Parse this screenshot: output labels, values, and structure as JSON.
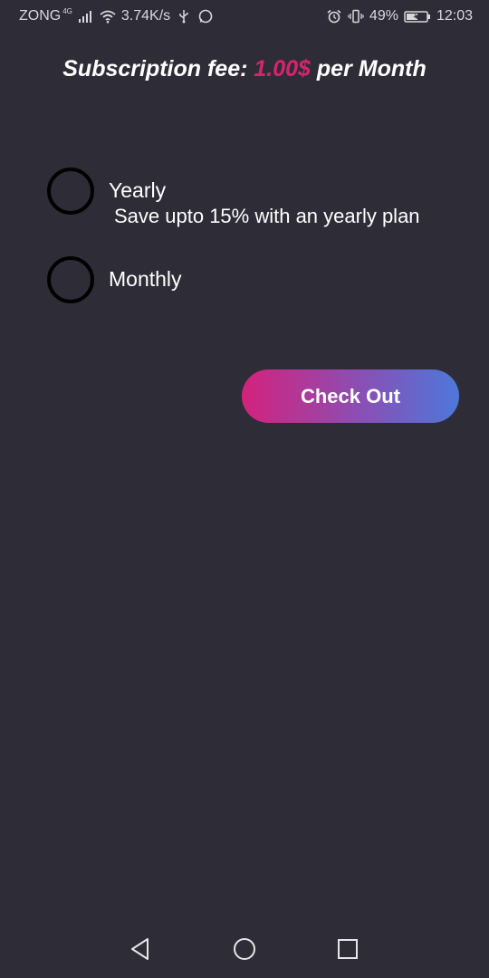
{
  "status_bar": {
    "carrier": "ZONG",
    "network_type": "4G",
    "speed": "3.74K/s",
    "battery": "49%",
    "time": "12:03",
    "icons": [
      "signal-icon",
      "wifi-icon",
      "usb-icon",
      "whatsapp-icon",
      "alarm-icon",
      "vibrate-icon",
      "battery-icon"
    ]
  },
  "header": {
    "prefix": "Subscription fee:",
    "price": "1.00$",
    "suffix": "per Month",
    "price_color": "#d6246e"
  },
  "options": [
    {
      "label": "Yearly",
      "sublabel": "Save upto 15% with an yearly plan",
      "selected": false
    },
    {
      "label": "Monthly",
      "selected": false
    }
  ],
  "checkout": {
    "label": "Check Out",
    "gradient_start": "#d4227c",
    "gradient_end": "#4c78d9"
  },
  "nav_bar": {
    "icons": [
      "back-icon",
      "home-icon",
      "recent-apps-icon"
    ]
  },
  "colors": {
    "background": "#2e2d37",
    "text": "#ffffff",
    "radio_border": "#000000"
  }
}
